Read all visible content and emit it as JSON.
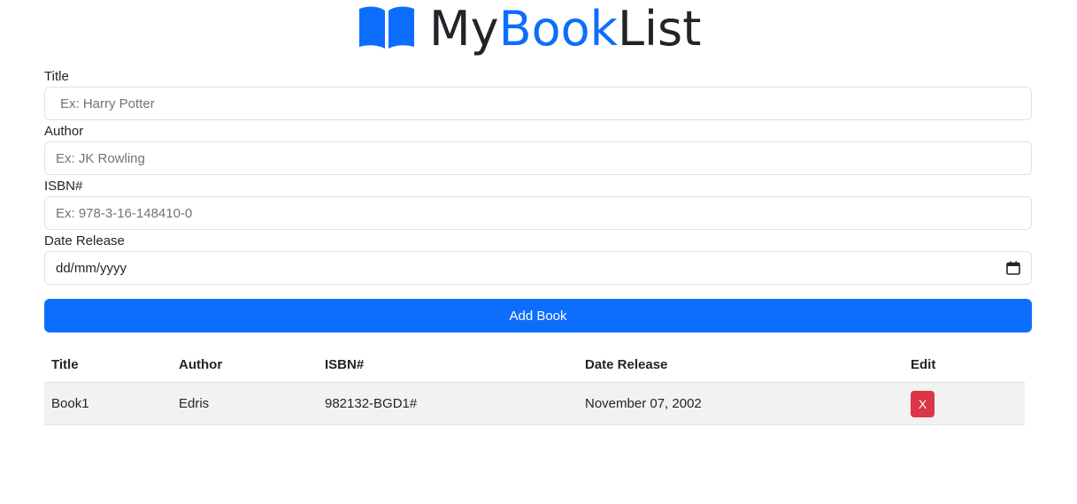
{
  "brand": {
    "part1": "My",
    "part2": "Book",
    "part3": "List",
    "accent_color": "#0d6efd",
    "icon": "open-book-icon"
  },
  "form": {
    "title_label": "Title",
    "title_placeholder": "Ex: Harry Potter",
    "author_label": "Author",
    "author_placeholder": "Ex: JK Rowling",
    "isbn_label": "ISBN#",
    "isbn_placeholder": "Ex: 978-3-16-148410-0",
    "date_label": "Date Release",
    "date_placeholder": "dd/mm/yyyy",
    "date_icon": "calendar-icon",
    "submit_label": "Add Book"
  },
  "table": {
    "headers": [
      "Title",
      "Author",
      "ISBN#",
      "Date Release",
      "Edit"
    ],
    "rows": [
      {
        "title": "Book1",
        "author": "Edris",
        "isbn": "982132-BGD1#",
        "date": "November 07, 2002",
        "delete_label": "X"
      }
    ]
  },
  "colors": {
    "primary": "#0d6efd",
    "danger": "#dc3545"
  }
}
